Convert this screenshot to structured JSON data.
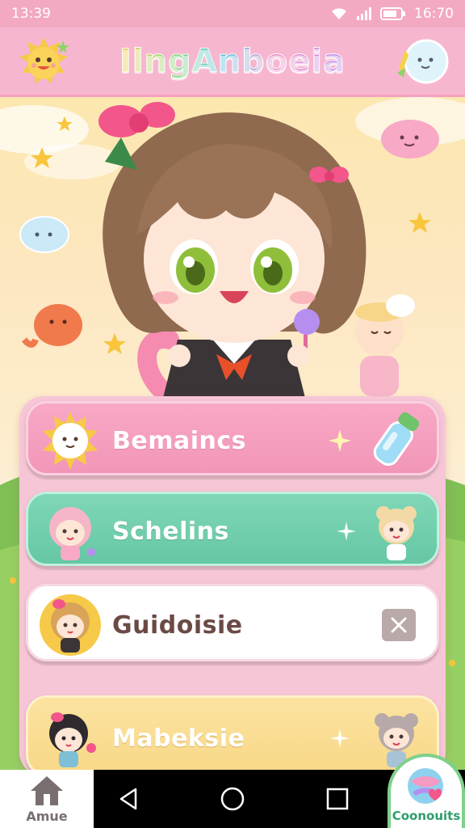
{
  "status_bar": {
    "time": "13:39",
    "right_time": "16:70"
  },
  "header": {
    "title": "IlngAnboeia"
  },
  "menu": [
    {
      "label": "Bemaincs",
      "color": "#f29cbd"
    },
    {
      "label": "Schelins",
      "color": "#6fceaa"
    },
    {
      "label": "Guidoisie",
      "color": "#ffffff"
    },
    {
      "label": "Mabeksie",
      "color": "#f9dc8e"
    }
  ],
  "nav": {
    "home_label": "Amue",
    "connect_label": "Coonouits"
  },
  "colors": {
    "pink": "#f7b6cf",
    "green": "#7fd7b6",
    "yellow": "#fbe3a0",
    "nav": "#000000"
  }
}
